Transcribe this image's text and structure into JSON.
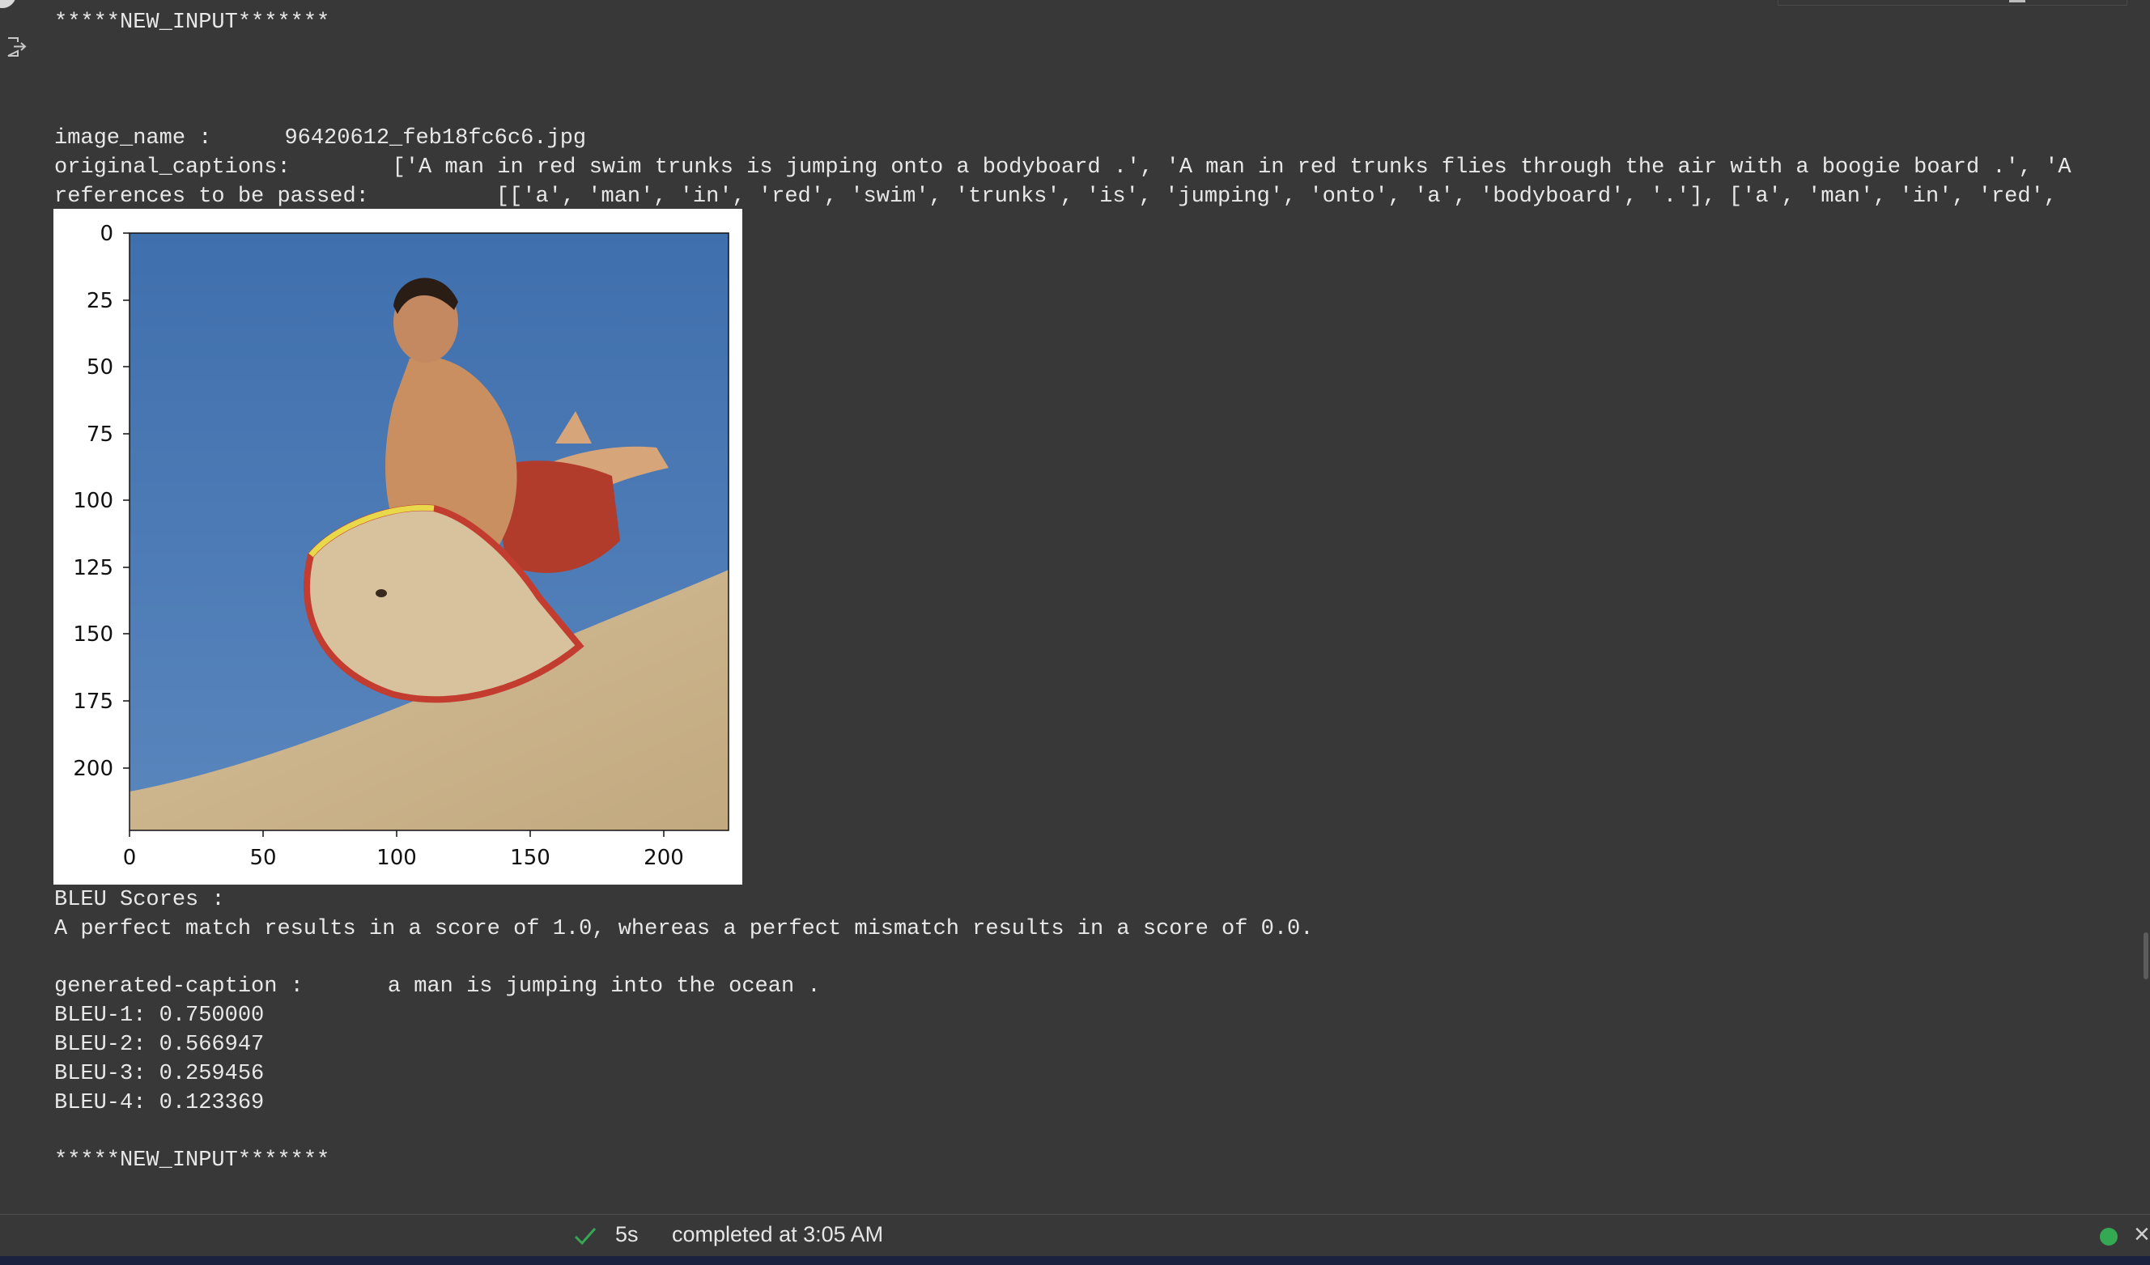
{
  "output": {
    "new_input_marker_top": "*****NEW_INPUT*******",
    "image_name_label": "image_name :",
    "image_name_value": "96420612_feb18fc6c6.jpg",
    "original_captions_label": "original_captions:",
    "original_captions_value": "['A man in red swim trunks is jumping onto a bodyboard .', 'A man in red trunks flies through the air with a boogie board .', 'A",
    "references_label": "references to be passed:",
    "references_value": "[['a', 'man', 'in', 'red', 'swim', 'trunks', 'is', 'jumping', 'onto', 'a', 'bodyboard', '.'], ['a', 'man', 'in', 'red',",
    "bleu_heading": "BLEU Scores :",
    "bleu_note": "A perfect match results in a score of 1.0, whereas a perfect mismatch results in a score of 0.0.",
    "generated_caption_label": "generated-caption :",
    "generated_caption_value": "a man is jumping into the ocean .",
    "bleu_scores": [
      {
        "label": "BLEU-1:",
        "value": "0.750000"
      },
      {
        "label": "BLEU-2:",
        "value": "0.566947"
      },
      {
        "label": "BLEU-3:",
        "value": "0.259456"
      },
      {
        "label": "BLEU-4:",
        "value": "0.123369"
      }
    ],
    "new_input_marker_bottom": "*****NEW_INPUT*******"
  },
  "figure": {
    "y_ticks": [
      "0",
      "25",
      "50",
      "75",
      "100",
      "125",
      "150",
      "175",
      "200"
    ],
    "x_ticks": [
      "0",
      "50",
      "100",
      "150",
      "200"
    ]
  },
  "status": {
    "duration": "5s",
    "completed_text": "completed at 3:05 AM"
  },
  "icons": {
    "output": "output-arrow-icon",
    "check": "check-icon",
    "dot": "status-dot-icon",
    "close": "close-icon"
  },
  "colors": {
    "background": "#383838",
    "text": "#e8e8e8",
    "status_green": "#34a853",
    "sky": "#4a76b0",
    "sand": "#cbb48e"
  }
}
